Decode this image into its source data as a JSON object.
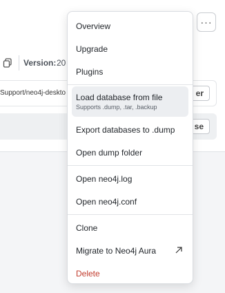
{
  "background": {
    "version_label": "Version:",
    "version_value": "20",
    "path_text": "Support/neo4j-deskto",
    "row_buttons": [
      "er",
      "se"
    ]
  },
  "more_button": {
    "label": "···"
  },
  "menu": {
    "items": [
      {
        "label": "Overview"
      },
      {
        "label": "Upgrade"
      },
      {
        "label": "Plugins"
      },
      {
        "label": "Load database from file",
        "sublabel": "Supports .dump, .tar, .backup"
      },
      {
        "label": "Export databases to .dump"
      },
      {
        "label": "Open dump folder"
      },
      {
        "label": "Open neo4j.log"
      },
      {
        "label": "Open neo4j.conf"
      },
      {
        "label": "Clone"
      },
      {
        "label": "Migrate to Neo4j Aura"
      },
      {
        "label": "Delete"
      }
    ]
  },
  "colors": {
    "danger": "#c0392b",
    "highlight": "#eceef1"
  }
}
